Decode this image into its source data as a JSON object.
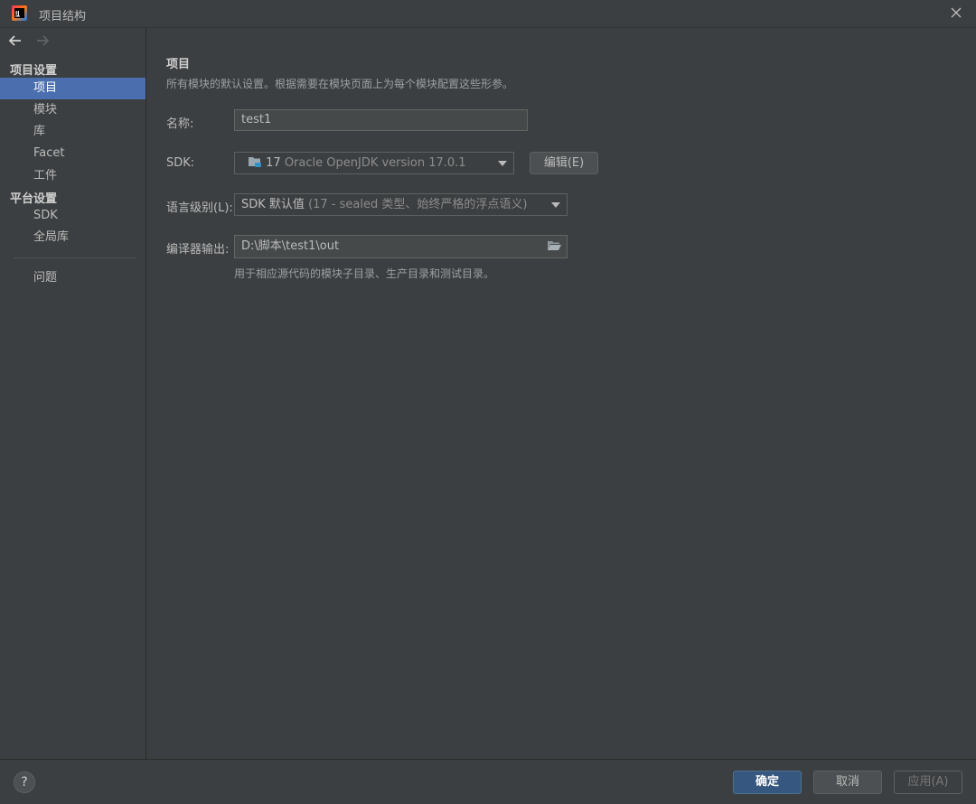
{
  "window": {
    "title": "项目结构"
  },
  "sidebar": {
    "sections": [
      {
        "header": "项目设置",
        "items": [
          {
            "label": "项目",
            "selected": true
          },
          {
            "label": "模块",
            "selected": false
          },
          {
            "label": "库",
            "selected": false
          },
          {
            "label": "Facet",
            "selected": false
          },
          {
            "label": "工件",
            "selected": false
          }
        ]
      },
      {
        "header": "平台设置",
        "items": [
          {
            "label": "SDK",
            "selected": false
          },
          {
            "label": "全局库",
            "selected": false
          }
        ]
      }
    ],
    "extra_items": [
      {
        "label": "问题"
      }
    ]
  },
  "main": {
    "title": "项目",
    "description": "所有模块的默认设置。根据需要在模块页面上为每个模块配置这些形参。",
    "name_field": {
      "label": "名称:",
      "value": "test1"
    },
    "sdk_field": {
      "label": "SDK:",
      "version_prefix": "17",
      "version_detail": "Oracle OpenJDK version 17.0.1",
      "edit_button": "编辑(E)"
    },
    "language_level_field": {
      "label": "语言级别(L):",
      "value_main": "SDK 默认值",
      "value_detail": "(17 - sealed 类型、始终严格的浮点语义)"
    },
    "compiler_output_field": {
      "label": "编译器输出:",
      "value": "D:\\脚本\\test1\\out",
      "hint": "用于相应源代码的模块子目录、生产目录和测试目录。"
    }
  },
  "footer": {
    "help_label": "?",
    "ok_button": "确定",
    "cancel_button": "取消",
    "apply_button": "应用(A)"
  },
  "colors": {
    "background": "#3c3f41",
    "selection": "#4b6eaf",
    "primary_button": "#365880",
    "text": "#bbbbbb"
  },
  "icons": [
    "app-logo-icon",
    "close-icon",
    "back-arrow-icon",
    "forward-arrow-icon",
    "sdk-folder-icon",
    "dropdown-arrow-icon",
    "browse-folder-icon",
    "help-icon"
  ]
}
